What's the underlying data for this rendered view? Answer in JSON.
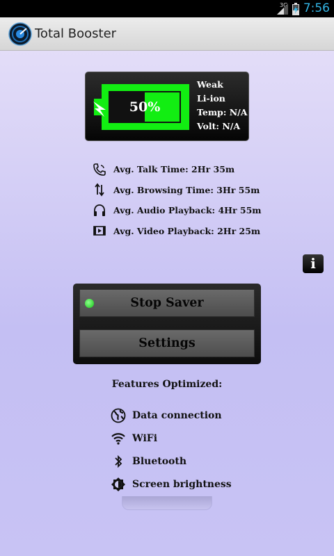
{
  "status_bar": {
    "network": "3G",
    "time": "7:56"
  },
  "app": {
    "title": "Total Booster"
  },
  "battery": {
    "level_percent": 50,
    "level_label": "50%",
    "health": "Weak",
    "technology": "Li-ion",
    "temp": "Temp: N/A",
    "volt": "Volt: N/A",
    "fill_color": "#12ee12"
  },
  "usage": [
    {
      "icon": "phone-icon",
      "text": "Avg. Talk Time: 2Hr 35m"
    },
    {
      "icon": "data-arrows-icon",
      "text": "Avg. Browsing Time: 3Hr 55m"
    },
    {
      "icon": "headphones-icon",
      "text": "Avg. Audio Playback: 4Hr 55m"
    },
    {
      "icon": "video-icon",
      "text": "Avg. Video Playback: 2Hr 25m"
    }
  ],
  "info_button": {
    "label": "i"
  },
  "controls": {
    "stop_label": "Stop Saver",
    "settings_label": "Settings",
    "led_color": "#15c415"
  },
  "features": {
    "title": "Features Optimized:",
    "items": [
      {
        "icon": "globe-icon",
        "label": "Data connection"
      },
      {
        "icon": "wifi-icon",
        "label": "WiFi"
      },
      {
        "icon": "bluetooth-icon",
        "label": "Bluetooth"
      },
      {
        "icon": "brightness-icon",
        "label": "Screen brightness"
      }
    ]
  }
}
